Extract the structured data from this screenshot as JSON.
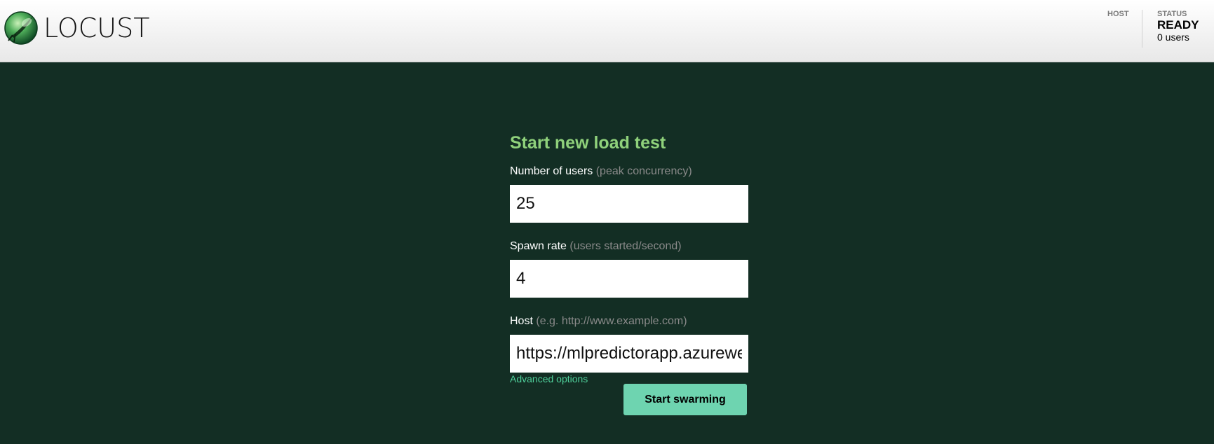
{
  "header": {
    "logo_text": "LOCUST",
    "host_label": "HOST",
    "status_label": "STATUS",
    "status_value": "READY",
    "user_count": "0 users"
  },
  "form": {
    "title": "Start new load test",
    "users": {
      "label": "Number of users",
      "hint": "(peak concurrency)",
      "value": "25"
    },
    "spawn_rate": {
      "label": "Spawn rate",
      "hint": "(users started/second)",
      "value": "4"
    },
    "host": {
      "label": "Host",
      "hint": "(e.g. http://www.example.com)",
      "value": "https://mlpredictorapp.azurewebsites.net"
    },
    "advanced_options": "Advanced options",
    "submit_label": "Start swarming"
  },
  "colors": {
    "background": "#132e24",
    "title_green": "#8fd17b",
    "button_green": "#6ed4b0",
    "link_green": "#4fcf9a"
  },
  "icons": {
    "logo": "locust-logo-icon"
  }
}
